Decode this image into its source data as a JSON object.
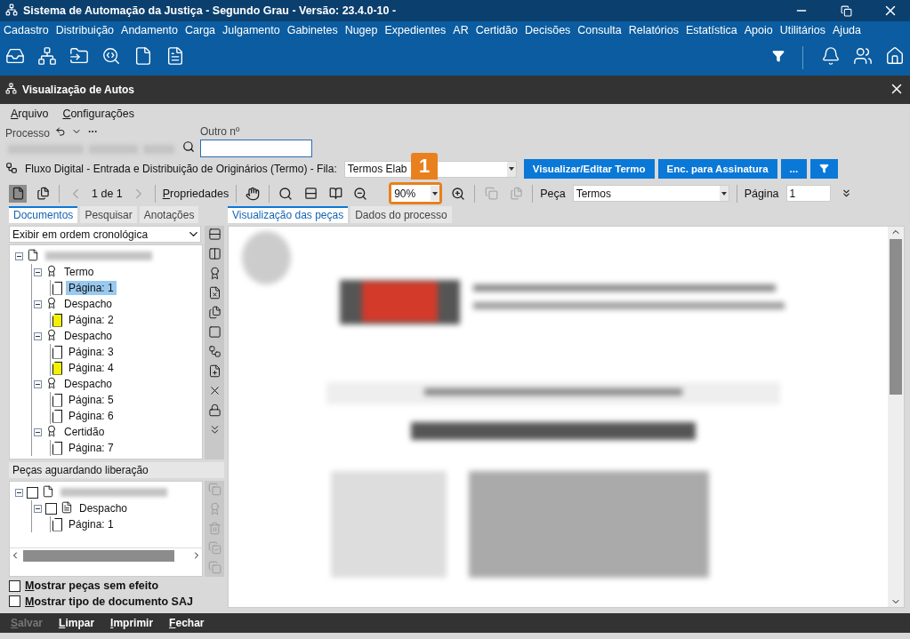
{
  "window": {
    "title": "Sistema de Automação da Justiça - Segundo Grau - Versão: 23.4.0-10 -"
  },
  "menu": [
    "Cadastro",
    "Distribuição",
    "Andamento",
    "Carga",
    "Julgamento",
    "Gabinetes",
    "Nugep",
    "Expedientes",
    "AR",
    "Certidão",
    "Decisões",
    "Consulta",
    "Relatórios",
    "Estatística",
    "Apoio",
    "Utilitários",
    "Ajuda"
  ],
  "subwindow": {
    "title": "Visualização de Autos"
  },
  "submenu": [
    "Arquivo",
    "Configurações"
  ],
  "process": {
    "label": "Processo",
    "other_label": "Outro nº"
  },
  "workflow": {
    "text": "Fluxo Digital - Entrada e Distribuição de Originários (Termo) - Fila:",
    "queue": "Termos Elab",
    "buttons": [
      "Visualizar/Editar Termo",
      "Enc. para Assinatura",
      "..."
    ]
  },
  "toolbar": {
    "pager": "1 de 1",
    "properties": "Propriedades",
    "zoom": "90%",
    "piece_label": "Peça",
    "piece": "Termos",
    "page_label": "Página",
    "page": "1"
  },
  "callout": {
    "number": "1"
  },
  "left_tabs": [
    {
      "label": "Documentos",
      "selected": true
    },
    {
      "label": "Pesquisar",
      "selected": false
    },
    {
      "label": "Anotações",
      "selected": false
    }
  ],
  "order": "Exibir em ordem cronológica",
  "tree": [
    {
      "kind": "process",
      "expanded": true,
      "children": [
        {
          "kind": "piece",
          "label": "Termo",
          "expanded": true,
          "children": [
            {
              "kind": "page",
              "label": "Página: 1",
              "selected": true,
              "marked": false
            }
          ]
        },
        {
          "kind": "piece",
          "label": "Despacho",
          "expanded": true,
          "children": [
            {
              "kind": "page",
              "label": "Página: 2",
              "selected": false,
              "marked": true
            }
          ]
        },
        {
          "kind": "piece",
          "label": "Despacho",
          "expanded": true,
          "children": [
            {
              "kind": "page",
              "label": "Página: 3",
              "selected": false,
              "marked": false
            },
            {
              "kind": "page",
              "label": "Página: 4",
              "selected": false,
              "marked": true
            }
          ]
        },
        {
          "kind": "piece",
          "label": "Despacho",
          "expanded": true,
          "children": [
            {
              "kind": "page",
              "label": "Página: 5",
              "selected": false,
              "marked": false
            },
            {
              "kind": "page",
              "label": "Página: 6",
              "selected": false,
              "marked": false
            }
          ]
        },
        {
          "kind": "piece",
          "label": "Certidão",
          "expanded": true,
          "children": [
            {
              "kind": "page",
              "label": "Página: 7",
              "selected": false,
              "marked": false
            }
          ]
        }
      ]
    }
  ],
  "pending": {
    "title": "Peças aguardando liberação",
    "tree": [
      {
        "kind": "process",
        "checked": false,
        "expanded": true,
        "children": [
          {
            "kind": "doc",
            "label": "Despacho",
            "checked": false,
            "expanded": true,
            "children": [
              {
                "kind": "page",
                "label": "Página: 1",
                "selected": false,
                "marked": false
              }
            ]
          }
        ]
      }
    ]
  },
  "options": [
    {
      "label": "Mostrar peças sem efeito",
      "checked": false
    },
    {
      "label": "Mostrar tipo de documento SAJ",
      "checked": false
    }
  ],
  "right_tabs": [
    {
      "label": "Visualização das peças",
      "selected": true
    },
    {
      "label": "Dados do processo",
      "selected": false
    }
  ],
  "footer": [
    {
      "label": "Salvar",
      "disabled": true
    },
    {
      "label": "Limpar",
      "disabled": false
    },
    {
      "label": "Imprimir",
      "disabled": false
    },
    {
      "label": "Fechar",
      "disabled": false
    }
  ]
}
